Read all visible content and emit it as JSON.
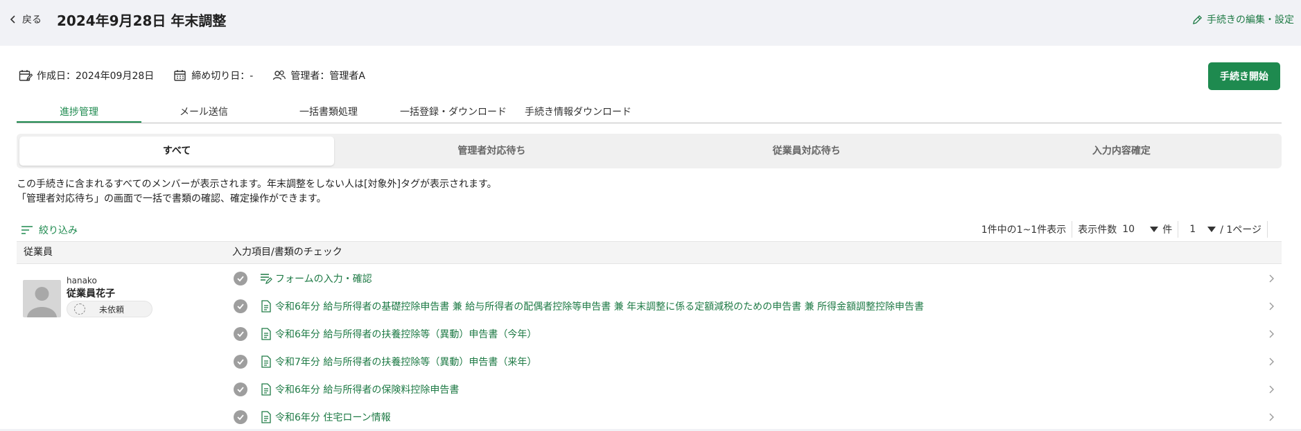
{
  "header": {
    "back_label": "戻る",
    "title": "2024年9月28日 年末調整",
    "edit_label": "手続きの編集・設定"
  },
  "meta": {
    "created": "作成日：2024年09月28日",
    "deadline": "締め切り日：-",
    "manager": "管理者：管理者A"
  },
  "start_button": "手続き開始",
  "tabs": [
    {
      "label": "進捗管理",
      "active": true
    },
    {
      "label": "メール送信"
    },
    {
      "label": "一括書類処理"
    },
    {
      "label": "一括登録・ダウンロード"
    },
    {
      "label": "手続き情報ダウンロード"
    }
  ],
  "segments": [
    {
      "label": "すべて",
      "active": true
    },
    {
      "label": "管理者対応待ち"
    },
    {
      "label": "従業員対応待ち"
    },
    {
      "label": "入力内容確定"
    }
  ],
  "description": {
    "line1": "この手続きに含まれるすべてのメンバーが表示されます。年末調整をしない人は[対象外]タグが表示されます。",
    "line2": "「管理者対応待ち」の画面で一括で書類の確認、確定操作ができます。"
  },
  "filter_label": "絞り込み",
  "pager": {
    "summary": "1件中の1~1件表示",
    "per_page_label": "表示件数",
    "per_page_value": "10",
    "per_page_unit": "件",
    "page_value": "1",
    "page_total": "/ 1ページ"
  },
  "table": {
    "col_employee": "従業員",
    "col_items": "入力項目/書類のチェック"
  },
  "employee": {
    "id": "hanako",
    "name": "従業員花子",
    "status": "未依頼"
  },
  "items": [
    {
      "label": "フォームの入力・確認",
      "icon": "form-edit-icon"
    },
    {
      "label": "令和6年分 給与所得者の基礎控除申告書 兼 給与所得者の配偶者控除等申告書 兼 年末調整に係る定額減税のための申告書 兼 所得金額調整控除申告書",
      "icon": "document-icon"
    },
    {
      "label": "令和6年分 給与所得者の扶養控除等（異動）申告書（今年）",
      "icon": "document-icon"
    },
    {
      "label": "令和7年分 給与所得者の扶養控除等（異動）申告書（来年）",
      "icon": "document-icon"
    },
    {
      "label": "令和6年分 給与所得者の保険料控除申告書",
      "icon": "document-icon"
    },
    {
      "label": "令和6年分 住宅ローン情報",
      "icon": "document-icon"
    }
  ],
  "colors": {
    "accent": "#1e8a4f",
    "link": "#1e7a45",
    "background": "#f1f2f6"
  }
}
